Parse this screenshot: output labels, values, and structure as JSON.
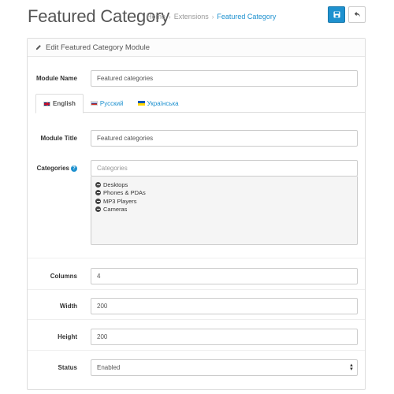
{
  "header": {
    "title": "Featured Category",
    "breadcrumb": [
      "Home",
      "Extensions",
      "Featured Category"
    ]
  },
  "panel": {
    "heading": "Edit Featured Category Module"
  },
  "form": {
    "module_name": {
      "label": "Module Name",
      "value": "Featured categories"
    },
    "tabs": [
      {
        "label": "English",
        "active": true,
        "flag": "uk-flag-icon"
      },
      {
        "label": "Русский",
        "active": false,
        "flag": "ru-flag-icon"
      },
      {
        "label": "Українська",
        "active": false,
        "flag": "ua-flag-icon"
      }
    ],
    "module_title": {
      "label": "Module Title",
      "value": "Featured categories"
    },
    "categories": {
      "label": "Categories",
      "placeholder": "Categories",
      "items": [
        "Desktops",
        "Phones & PDAs",
        "MP3 Players",
        "Cameras"
      ]
    },
    "columns": {
      "label": "Columns",
      "value": "4"
    },
    "width": {
      "label": "Width",
      "value": "200"
    },
    "height": {
      "label": "Height",
      "value": "200"
    },
    "status": {
      "label": "Status",
      "value": "Enabled"
    }
  },
  "colors": {
    "primary": "#1e91cf",
    "cat_box_bg": "#f5f5f5"
  }
}
